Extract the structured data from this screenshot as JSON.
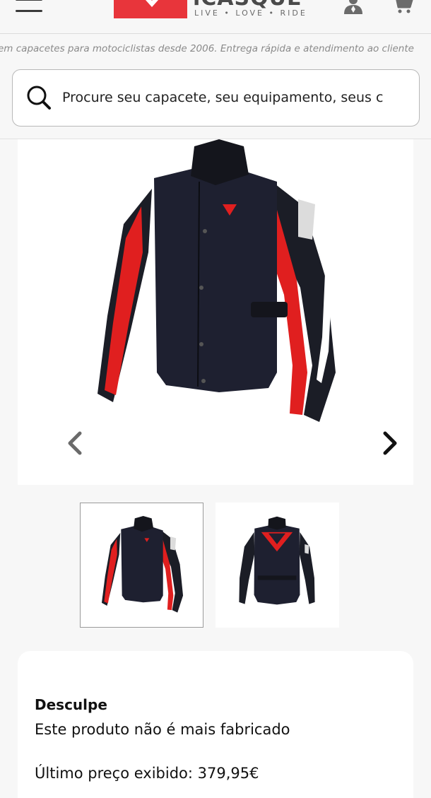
{
  "header": {
    "logo_word": "iCASQUE",
    "logo_tagline": "LIVE • LOVE • RIDE",
    "icons": [
      "menu-icon",
      "user-icon",
      "cart-icon"
    ]
  },
  "ticker": "em capacetes para motociclistas desde 2006. Entrega rápida e atendimento ao cliente",
  "search": {
    "placeholder": "Procure seu capacete, seu equipamento, seus c",
    "icon": "search-icon"
  },
  "gallery": {
    "prev_icon": "chevron-left-icon",
    "next_icon": "chevron-right-icon",
    "thumbnails": [
      "front-view",
      "back-view"
    ],
    "selected_index": 0
  },
  "notice": {
    "title": "Desculpe",
    "message": "Este produto não é mais fabricado",
    "last_price": "Último preço exibido: 379,95€"
  },
  "colors": {
    "brand_red": "#e8353b",
    "jacket_black": "#1b1d26",
    "jacket_red": "#e01f1f"
  }
}
